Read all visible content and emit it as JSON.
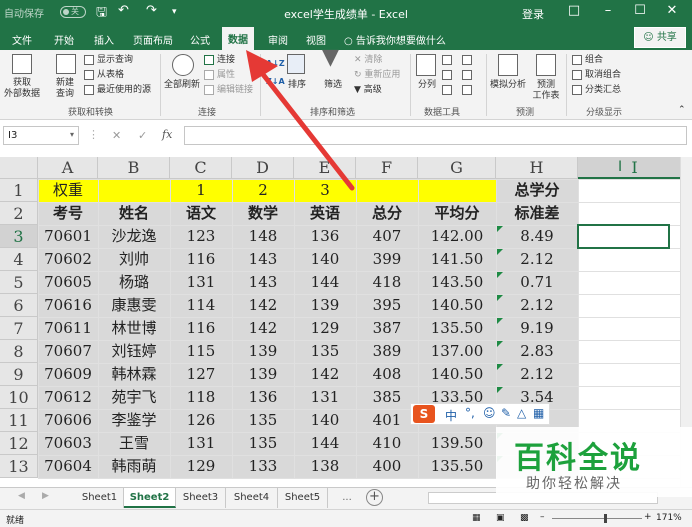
{
  "titlebar": {
    "autosave": "自动保存",
    "autosave_state": "关",
    "title": "excel学生成绩单  -  Excel",
    "login": "登录",
    "save_icon": "save-icon",
    "undo_icon": "undo-icon",
    "redo_icon": "redo-icon"
  },
  "tabs": [
    "文件",
    "开始",
    "插入",
    "页面布局",
    "公式",
    "数据",
    "审阅",
    "视图"
  ],
  "active_tab": "数据",
  "tell_me": "告诉我你想要做什么",
  "share": "共享",
  "ribbon": {
    "get_external": "获取\n外部数据",
    "new_query": "新建\n查询",
    "show_query": "显示查询",
    "from_table": "从表格",
    "recent_sources": "最近使用的源",
    "group1": "获取和转换",
    "refresh_all": "全部刷新",
    "connections": "连接",
    "properties": "属性",
    "edit_links": "编辑链接",
    "group2": "连接",
    "sort": "排序",
    "filter": "筛选",
    "clear": "清除",
    "reapply": "重新应用",
    "advanced": "高级",
    "group3": "排序和筛选",
    "text_to_cols": "分列",
    "group4": "数据工具",
    "what_if": "模拟分析",
    "forecast": "预测\n工作表",
    "group5": "预测",
    "group_btn": "组合",
    "ungroup": "取消组合",
    "subtotal": "分类汇总",
    "group6": "分级显示"
  },
  "name_box": "I3",
  "fx": "fx",
  "columns": [
    "A",
    "B",
    "C",
    "D",
    "E",
    "F",
    "G",
    "H",
    "I"
  ],
  "rows": [
    "1",
    "2",
    "3",
    "4",
    "5",
    "6",
    "7",
    "8",
    "9",
    "10",
    "11",
    "12",
    "13"
  ],
  "row1": [
    "权重",
    "",
    "1",
    "2",
    "3",
    "",
    "",
    "总学分",
    ""
  ],
  "row2": [
    "考号",
    "姓名",
    "语文",
    "数学",
    "英语",
    "总分",
    "平均分",
    "标准差",
    ""
  ],
  "data": [
    [
      "70601",
      "沙龙逸",
      "123",
      "148",
      "136",
      "407",
      "142.00",
      "8.49"
    ],
    [
      "70602",
      "刘帅",
      "116",
      "143",
      "140",
      "399",
      "141.50",
      "2.12"
    ],
    [
      "70605",
      "杨璐",
      "131",
      "143",
      "144",
      "418",
      "143.50",
      "0.71"
    ],
    [
      "70616",
      "康惠雯",
      "114",
      "142",
      "139",
      "395",
      "140.50",
      "2.12"
    ],
    [
      "70611",
      "林世博",
      "116",
      "142",
      "129",
      "387",
      "135.50",
      "9.19"
    ],
    [
      "70607",
      "刘钰婷",
      "115",
      "139",
      "135",
      "389",
      "137.00",
      "2.83"
    ],
    [
      "70609",
      "韩林霖",
      "127",
      "139",
      "142",
      "408",
      "140.50",
      "2.12"
    ],
    [
      "70612",
      "苑宇飞",
      "118",
      "136",
      "131",
      "385",
      "133.50",
      "3.54"
    ],
    [
      "70606",
      "李鉴学",
      "126",
      "135",
      "140",
      "401",
      "137.50",
      ""
    ],
    [
      "70603",
      "王雪",
      "131",
      "135",
      "144",
      "410",
      "139.50",
      ""
    ],
    [
      "70604",
      "韩雨萌",
      "129",
      "133",
      "138",
      "400",
      "135.50",
      ""
    ]
  ],
  "sheets": [
    "Sheet1",
    "Sheet2",
    "Sheet3",
    "Sheet4",
    "Sheet5"
  ],
  "active_sheet": "Sheet2",
  "status": "就绪",
  "zoom": "171%",
  "watermark": {
    "title": "百科全说",
    "subtitle": "助你轻松解决"
  },
  "colors": {
    "excel_green": "#217346",
    "yellow_row": "#ffff00",
    "gray_fill": "#d9d9d9",
    "arrow_red": "#e53935"
  }
}
